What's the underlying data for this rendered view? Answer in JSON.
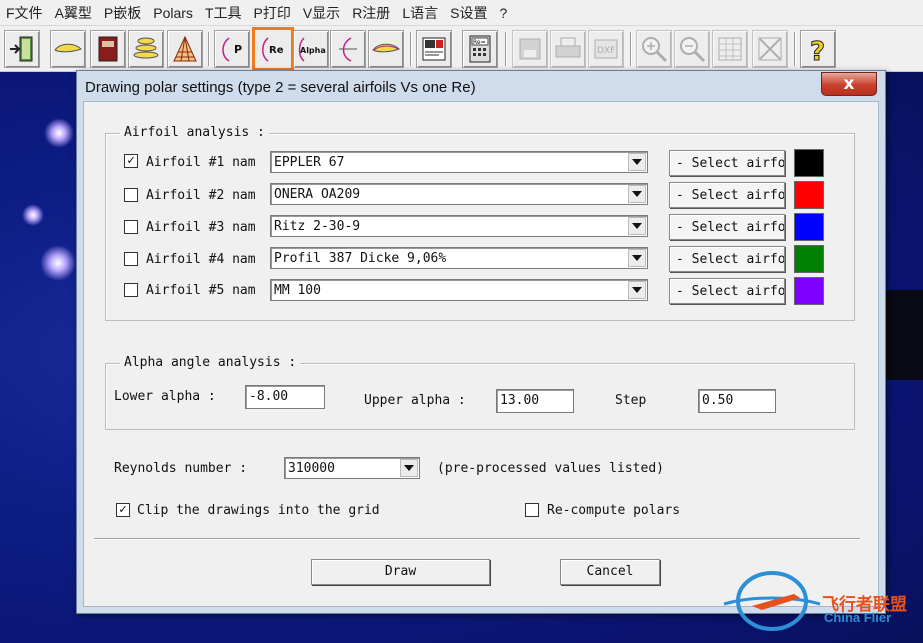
{
  "menu": [
    "F文件",
    "A翼型",
    "P嵌板",
    "Polars",
    "T工具",
    "P打印",
    "V显示",
    "R注册",
    "L语言",
    "S设置",
    "?"
  ],
  "toolbar": {
    "buttons": [
      {
        "icon": "exit-door-icon"
      },
      {
        "icon": "airfoil-icon"
      },
      {
        "icon": "book-icon"
      },
      {
        "icon": "stacked-airfoils-icon"
      },
      {
        "icon": "panels-icon"
      },
      {
        "icon": "polar-p-icon",
        "label": "P"
      },
      {
        "icon": "polar-re-icon",
        "label": "Re"
      },
      {
        "icon": "polar-alpha-icon",
        "label": "Alpha"
      },
      {
        "icon": "polar-curve-icon"
      },
      {
        "icon": "airfoil-compare-icon"
      },
      {
        "icon": "print-preview-icon"
      },
      {
        "icon": "re-calculator-icon",
        "label": "Re="
      },
      {
        "icon": "save-disk-icon"
      },
      {
        "icon": "printer-icon"
      },
      {
        "icon": "dxf-export-icon",
        "label": "DXF"
      },
      {
        "icon": "zoom-in-icon"
      },
      {
        "icon": "zoom-out-icon"
      },
      {
        "icon": "grid-table-icon"
      },
      {
        "icon": "close-x-icon"
      },
      {
        "icon": "help-icon",
        "label": "?"
      }
    ],
    "highlighted": "polar-re-icon"
  },
  "dialog": {
    "title": "Drawing polar settings (type 2 = several airfoils Vs one Re)",
    "close_label": "x",
    "airfoil_section": {
      "title": "Airfoil analysis :",
      "rows": [
        {
          "checked": true,
          "label": "Airfoil #1 nam",
          "value": "EPPLER 67",
          "button": "- Select airfoil",
          "color": "#000000"
        },
        {
          "checked": false,
          "label": "Airfoil #2 nam",
          "value": "ONERA OA209",
          "button": "- Select airfoil",
          "color": "#ff0000"
        },
        {
          "checked": false,
          "label": "Airfoil #3 nam",
          "value": "Ritz 2-30-9",
          "button": "- Select airfoil",
          "color": "#0000ff"
        },
        {
          "checked": false,
          "label": "Airfoil #4 nam",
          "value": "Profil 387  Dicke 9,06%",
          "button": "- Select airfoil",
          "color": "#008000"
        },
        {
          "checked": false,
          "label": "Airfoil #5 nam",
          "value": "MM 100",
          "button": "- Select airfoil",
          "color": "#8000ff"
        }
      ]
    },
    "alpha_section": {
      "title": "Alpha angle analysis  :",
      "lower_label": "Lower alpha :",
      "lower_value": "-8.00",
      "upper_label": "Upper alpha :",
      "upper_value": "13.00",
      "step_label": "Step",
      "step_value": "0.50"
    },
    "reynolds": {
      "label": "Reynolds number :",
      "value": "310000",
      "note": "(pre-processed values listed)"
    },
    "clip_checkbox": {
      "checked": true,
      "label": "Clip the drawings into the grid"
    },
    "recompute_checkbox": {
      "checked": false,
      "label": "Re-compute polars"
    },
    "draw_button": "Draw",
    "cancel_button": "Cancel"
  },
  "watermark": {
    "cn": "飞行者联盟",
    "en": "China Flier"
  }
}
